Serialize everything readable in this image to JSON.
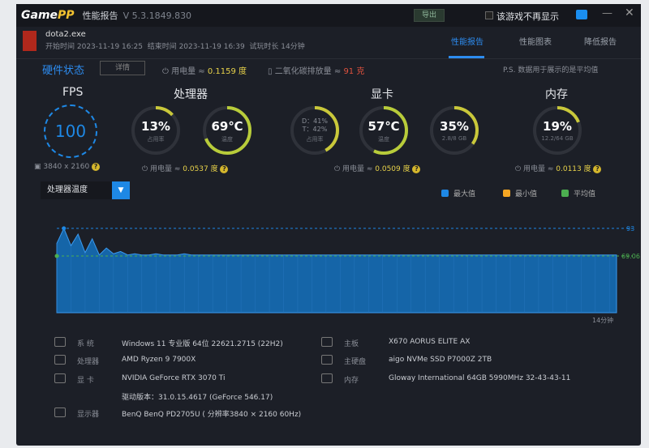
{
  "titlebar": {
    "brand_a": "Game",
    "brand_b": "PP",
    "title": "性能报告",
    "version": "V 5.3.1849.830",
    "export": "导出",
    "dont_show": "该游戏不再显示"
  },
  "game": {
    "name": "dota2.exe",
    "start": "开始时间 2023-11-19 16:25",
    "end": "结束时间 2023-11-19 16:39",
    "duration": "试玩时长 14分钟"
  },
  "tabs": [
    {
      "label": "性能报告"
    },
    {
      "label": "性能图表"
    },
    {
      "label": "降低报告"
    }
  ],
  "hw": {
    "title": "硬件状态",
    "detail": "详情",
    "power_label": "用电量 ≈ ",
    "power_value": "0.1159 度",
    "carbon_label": "二氧化碳排放量 ≈ ",
    "carbon_value": "91 克",
    "ps": "P.S. 数据用于展示的是平均值"
  },
  "sections": {
    "fps": "FPS",
    "cpu": "处理器",
    "gpu": "显卡",
    "mem": "内存"
  },
  "fps": {
    "value": "100",
    "resolution": "3840 x 2160"
  },
  "cpu": {
    "usage": "13%",
    "usage_label": "占用率",
    "usage_frac": 0.13,
    "temp": "69℃",
    "temp_label": "温度",
    "temp_frac": 0.69,
    "power_label": "用电量 ≈ ",
    "power": "0.0537 度"
  },
  "gpu": {
    "dt": "D：41%",
    "tt": "T：42%",
    "usage_label": "占用率",
    "usage_frac": 0.42,
    "temp": "57℃",
    "temp_label": "温度",
    "temp_frac": 0.57,
    "vram": "35%",
    "vram_label": "2.8/8 GB",
    "vram_frac": 0.35,
    "power_label": "用电量 ≈ ",
    "power": "0.0509 度"
  },
  "mem": {
    "usage": "19%",
    "usage_label": "12.2/64 GB",
    "usage_frac": 0.19,
    "power_label": "用电量 ≈ ",
    "power": "0.0113 度"
  },
  "chart_select": "处理器温度",
  "legend": [
    {
      "label": "最大值",
      "color": "#1e88e5"
    },
    {
      "label": "最小值",
      "color": "#f5a623"
    },
    {
      "label": "平均值",
      "color": "#4caf50"
    }
  ],
  "chart_data": {
    "type": "area",
    "title": "处理器温度",
    "ylim": [
      0,
      100
    ],
    "max": 93,
    "avg": 69.06,
    "max_label": "93",
    "avg_label": "69.06",
    "xlabel": "14分钟",
    "values": [
      80,
      93,
      78,
      88,
      72,
      84,
      70,
      76,
      71,
      73,
      70,
      71,
      70,
      70,
      71,
      70,
      70,
      70,
      71,
      70,
      70,
      70,
      70,
      70,
      70,
      70,
      70,
      70,
      70,
      70,
      70,
      70,
      70,
      70,
      70,
      70,
      70,
      70,
      70,
      70,
      70,
      70,
      70,
      70,
      70,
      70,
      70,
      70,
      70,
      70,
      70,
      70,
      70,
      70,
      70,
      70,
      70,
      70,
      70,
      70,
      70,
      70,
      70,
      70,
      70,
      70,
      70,
      70,
      70,
      70,
      70,
      70,
      70,
      70,
      70,
      70,
      70,
      70,
      70,
      70
    ]
  },
  "sysinfo": [
    {
      "label": "系  统",
      "value": "Windows 11 专业版 64位 22621.2715 (22H2)"
    },
    {
      "label": "处理器",
      "value": "AMD Ryzen 9 7900X"
    },
    {
      "label": "显  卡",
      "value": "NVIDIA GeForce RTX 3070 Ti",
      "extra": "驱动版本：31.0.15.4617 (GeForce 546.17)"
    },
    {
      "label": "显示器",
      "value": "BenQ BenQ PD2705U ( 分辨率3840 × 2160 60Hz)"
    },
    {
      "label": "主板",
      "value": "X670 AORUS ELITE AX"
    },
    {
      "label": "主硬盘",
      "value": "aigo NVMe SSD P7000Z 2TB"
    },
    {
      "label": "内存",
      "value": "Gloway International 64GB 5990MHz 32-43-43-11"
    }
  ]
}
